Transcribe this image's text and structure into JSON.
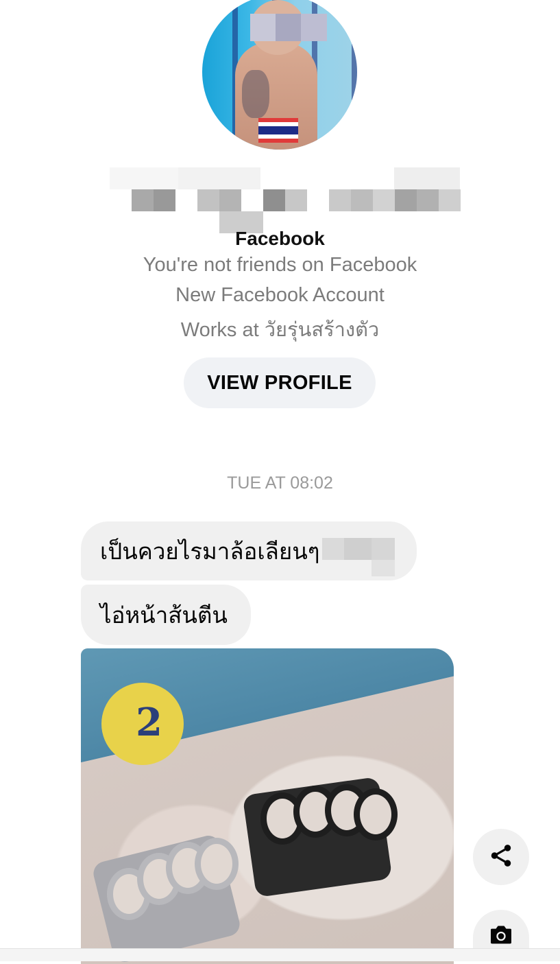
{
  "profile": {
    "network_label": "Facebook",
    "friend_status": "You're not friends on Facebook",
    "account_note": "New Facebook Account",
    "work_info": "Works at วัยรุ่นสร้างตัว",
    "view_profile_label": "VIEW PROFILE"
  },
  "conversation": {
    "timestamp": "TUE AT 08:02",
    "messages": [
      {
        "text": "เป็นควยไรมาล้อเลียนๆ"
      },
      {
        "text": "ไอ่หน้าส้นตีน"
      }
    ],
    "photo_overlay_text": "2"
  },
  "actions": {
    "share_icon": "share-icon",
    "camera_icon": "camera-icon"
  },
  "colors": {
    "bubble": "#f0f0f0",
    "button": "#f0f2f5",
    "secondary_text": "#7b7b7b"
  }
}
